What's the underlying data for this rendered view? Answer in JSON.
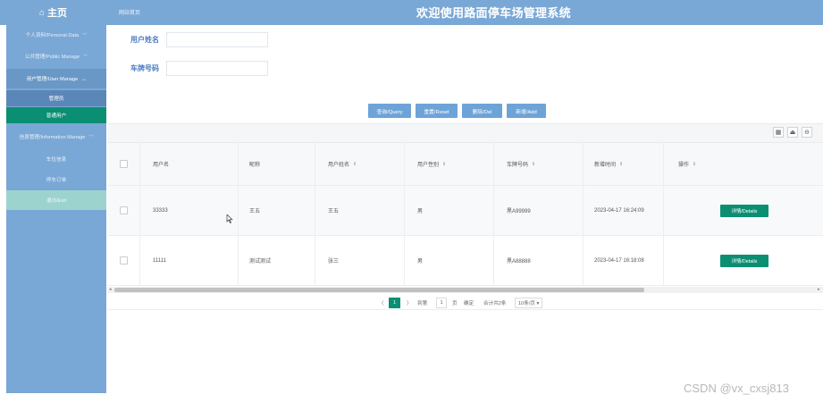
{
  "header": {
    "home_title": "主页",
    "site_home": "网站首页",
    "app_title": "欢迎使用路面停车场管理系统"
  },
  "sidebar": {
    "items": [
      {
        "label": "个人资料/Personal Data",
        "chevron": "﹀"
      },
      {
        "label": "公共管理/Public Manage",
        "chevron": "﹀"
      },
      {
        "label": "用户管理/User Manage",
        "chevron": "︿"
      },
      {
        "label": "管理员"
      },
      {
        "label": "普通用户"
      },
      {
        "label": "信息管理/Information Manage",
        "chevron": "﹀"
      },
      {
        "label": "车位信息"
      },
      {
        "label": "停车订单"
      },
      {
        "label": "退出/Exit"
      }
    ]
  },
  "search": {
    "username_label": "用户姓名",
    "username_value": "",
    "plate_label": "车牌号码",
    "plate_value": ""
  },
  "actions": {
    "query": "查询/Query",
    "reset": "重置/Reset",
    "delete": "删除/Del",
    "add": "新增/Add"
  },
  "tools": {
    "grid_icon": "▦",
    "export_icon": "⏏",
    "print_icon": "⊖"
  },
  "table": {
    "headers": [
      "用户名",
      "昵称",
      "用户姓名",
      "用户性别",
      "车牌号码",
      "新增时间",
      "操作"
    ],
    "sort_mark": "⇕",
    "rows": [
      {
        "username": "33333",
        "nickname": "王五",
        "real_name": "王五",
        "gender": "男",
        "plate": "黑A99999",
        "created": "2023-04-17 16:24:09",
        "action": "详情/Details"
      },
      {
        "username": "11111",
        "nickname": "测试测试",
        "real_name": "张三",
        "gender": "男",
        "plate": "黑A88888",
        "created": "2023-04-17 16:18:08",
        "action": "详情/Details"
      }
    ]
  },
  "pagination": {
    "prev": "〈",
    "current": "1",
    "next": "〉",
    "goto_prefix": "到第",
    "goto_value": "1",
    "goto_suffix": "页",
    "confirm": "确定",
    "total": "合计共2条",
    "page_size": "10条/页 ▾"
  },
  "watermark": "CSDN @vx_cxsj813"
}
